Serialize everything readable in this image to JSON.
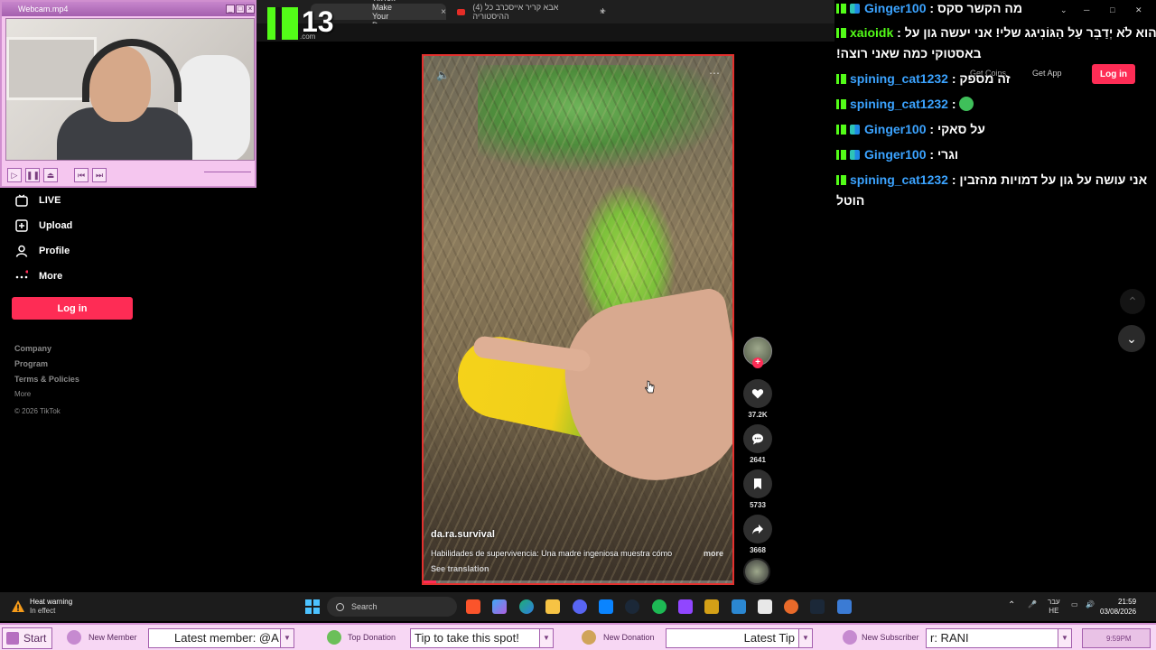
{
  "browser": {
    "tabs": [
      {
        "label": "TikTok - Make Your Day",
        "active": true
      },
      {
        "label": "(4) אבא קריר אייסכרב כל ההיסטוריה",
        "active": false
      }
    ],
    "close_glyph": "×",
    "new_tab_glyph": "+"
  },
  "kick_overlay": {
    "number": "13",
    "domain": ".com",
    "brand_color": "#53fc18"
  },
  "webcam": {
    "title": "Webcam.mp4",
    "controls": [
      "play-icon",
      "pause-icon",
      "eject-icon",
      "previous-icon",
      "next-icon"
    ]
  },
  "sidebar": {
    "items": [
      {
        "label": "LIVE",
        "icon": "live-tv-icon"
      },
      {
        "label": "Upload",
        "icon": "upload-plus-icon"
      },
      {
        "label": "Profile",
        "icon": "person-icon"
      },
      {
        "label": "More",
        "icon": "more-dots-icon"
      }
    ],
    "login_label": "Log in",
    "footer_links": [
      "Company",
      "Program",
      "Terms & Policies"
    ],
    "footer_more": "More",
    "copyright": "© 2026 TikTok"
  },
  "header": {
    "get_coins": "Get Coins",
    "get_app": "Get App",
    "login": "Log in",
    "accent": "#fe2c55"
  },
  "video": {
    "username": "da.ra.survival",
    "description": "Habilidades de supervivencia: Una madre ingeniosa muestra cómo",
    "more": "more",
    "see_translation": "See translation",
    "progress_fraction": 0.04
  },
  "actions": [
    {
      "name": "like-button",
      "icon": "heart-icon",
      "count": "37.2K"
    },
    {
      "name": "comment-button",
      "icon": "comment-icon",
      "count": "2641"
    },
    {
      "name": "bookmark-button",
      "icon": "bookmark-icon",
      "count": "5733"
    },
    {
      "name": "share-button",
      "icon": "share-icon",
      "count": "3668"
    }
  ],
  "chat": [
    {
      "user": "Ginger100",
      "sep": " : ",
      "msg": "מה הקשר סקס",
      "badge2": true,
      "user_color": "#3ba3ff"
    },
    {
      "user": "xaioidk",
      "sep": " : ",
      "msg": "הוא לֹא יְדַבֵּר עַל הַגּוֹנִיגג שלי! אני יעשה גון על",
      "badge2": false,
      "user_color": "#53fc18"
    },
    {
      "user": "",
      "sep": "",
      "msg": "!באסטוקי כמה שאני רוצה",
      "badge2": false,
      "user_color": "#3ba3ff"
    },
    {
      "user": "spining_cat1232",
      "sep": " : ",
      "msg": "זה מספק",
      "badge2": false,
      "user_color": "#3ba3ff"
    },
    {
      "user": "spining_cat1232",
      "sep": " : ",
      "msg": "",
      "badge2": false,
      "user_color": "#3ba3ff",
      "emoji": true
    },
    {
      "user": "Ginger100",
      "sep": " : ",
      "msg": "על סאקי",
      "badge2": true,
      "user_color": "#3ba3ff"
    },
    {
      "user": "Ginger100",
      "sep": " : ",
      "msg": "וגרי",
      "badge2": true,
      "user_color": "#3ba3ff"
    },
    {
      "user": "spining_cat1232",
      "sep": " : ",
      "msg": "אני עושה על גון על דמויות מהזבין",
      "badge2": false,
      "user_color": "#3ba3ff"
    },
    {
      "user": "",
      "sep": "",
      "msg": "הוטל",
      "badge2": false,
      "user_color": "#3ba3ff"
    }
  ],
  "taskbar": {
    "weather_title": "Heat warning",
    "weather_sub": "In effect",
    "search_placeholder": "Search",
    "lang_top": "עבר",
    "lang_bottom": "HE",
    "time": "21:59",
    "date": "03/08/2026"
  },
  "widgets": {
    "start": "Start",
    "new_member_label": "New Member",
    "new_member_value": "Latest member: @A",
    "top_donation_label": "Top Donation",
    "top_donation_value": "Tip to take this spot!",
    "new_donation_label": "New Donation",
    "new_donation_value": "Latest Tip",
    "new_subscriber_label": "New Subscriber",
    "new_subscriber_value": "r: RANI",
    "clock": "9:59PM"
  }
}
